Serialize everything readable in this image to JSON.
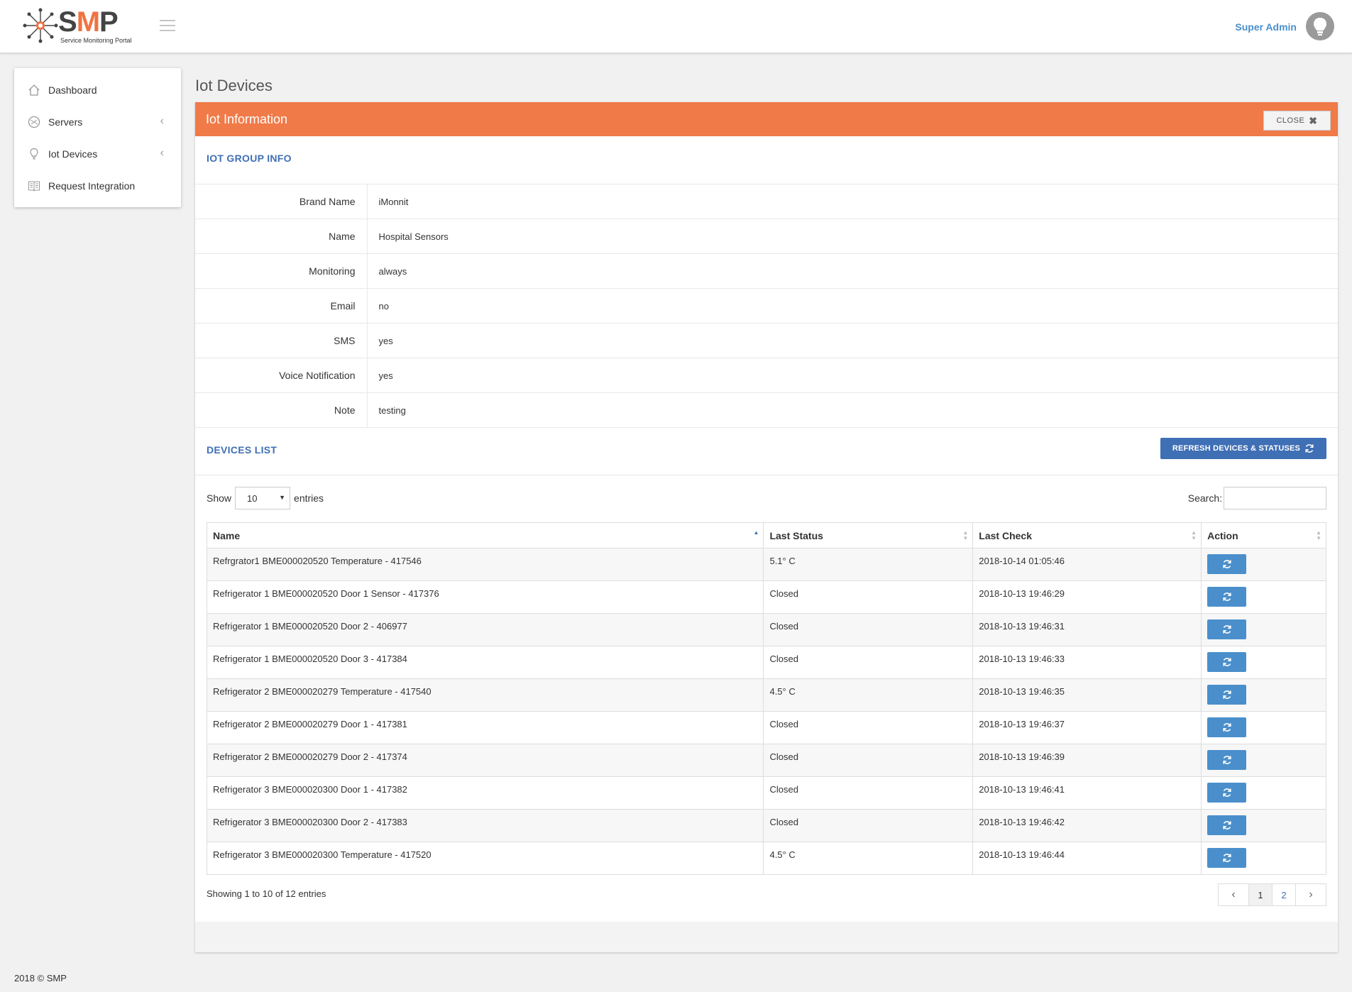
{
  "header": {
    "logo_text_s": "S",
    "logo_text_m": "M",
    "logo_text_p": "P",
    "logo_subtitle": "Service Monitoring Portal",
    "user_name": "Super Admin"
  },
  "sidebar": {
    "items": [
      {
        "label": "Dashboard",
        "icon": "home-icon"
      },
      {
        "label": "Servers",
        "icon": "server-icon",
        "chevron": "‹"
      },
      {
        "label": "Iot Devices",
        "icon": "bulb-icon",
        "chevron": "‹"
      },
      {
        "label": "Request Integration",
        "icon": "book-icon"
      }
    ]
  },
  "page": {
    "title": "Iot Devices"
  },
  "panel": {
    "title": "Iot Information",
    "close_label": "CLOSE",
    "group_section_title": "IOT GROUP INFO",
    "devices_section_title": "DEVICES LIST",
    "refresh_label": "REFRESH DEVICES & STATUSES"
  },
  "group_info": [
    {
      "label": "Brand Name",
      "value": "iMonnit"
    },
    {
      "label": "Name",
      "value": "Hospital Sensors"
    },
    {
      "label": "Monitoring",
      "value": "always"
    },
    {
      "label": "Email",
      "value": "no"
    },
    {
      "label": "SMS",
      "value": "yes"
    },
    {
      "label": "Voice Notification",
      "value": "yes"
    },
    {
      "label": "Note",
      "value": "testing"
    }
  ],
  "table_controls": {
    "show_label": "Show",
    "entries_value": "10",
    "entries_label": "entries",
    "search_label": "Search:",
    "search_value": ""
  },
  "devices_table": {
    "columns": [
      "Name",
      "Last Status",
      "Last Check",
      "Action"
    ],
    "rows": [
      {
        "name": "Refrgrator1 BME000020520 Temperature - 417546",
        "status": "5.1° C",
        "check": "2018-10-14 01:05:46"
      },
      {
        "name": "Refrigerator 1 BME000020520 Door 1 Sensor - 417376",
        "status": "Closed",
        "check": "2018-10-13 19:46:29"
      },
      {
        "name": "Refrigerator 1 BME000020520 Door 2 - 406977",
        "status": "Closed",
        "check": "2018-10-13 19:46:31"
      },
      {
        "name": "Refrigerator 1 BME000020520 Door 3 - 417384",
        "status": "Closed",
        "check": "2018-10-13 19:46:33"
      },
      {
        "name": "Refrigerator 2 BME000020279 Temperature - 417540",
        "status": "4.5° C",
        "check": "2018-10-13 19:46:35"
      },
      {
        "name": "Refrigerator 2 BME000020279 Door 1 - 417381",
        "status": "Closed",
        "check": "2018-10-13 19:46:37"
      },
      {
        "name": "Refrigerator 2 BME000020279 Door 2 - 417374",
        "status": "Closed",
        "check": "2018-10-13 19:46:39"
      },
      {
        "name": "Refrigerator 3 BME000020300 Door 1 - 417382",
        "status": "Closed",
        "check": "2018-10-13 19:46:41"
      },
      {
        "name": "Refrigerator 3 BME000020300 Door 2 - 417383",
        "status": "Closed",
        "check": "2018-10-13 19:46:42"
      },
      {
        "name": "Refrigerator 3 BME000020300 Temperature - 417520",
        "status": "4.5° C",
        "check": "2018-10-13 19:46:44"
      }
    ]
  },
  "pagination": {
    "info": "Showing 1 to 10 of 12 entries",
    "prev": "‹",
    "pages": [
      "1",
      "2"
    ],
    "next": "›",
    "current": "1"
  },
  "footer": {
    "copyright": "2018 © SMP"
  },
  "colors": {
    "accent_orange": "#f07a48",
    "primary_blue": "#3f6fb5",
    "action_blue": "#4a8fcb"
  }
}
